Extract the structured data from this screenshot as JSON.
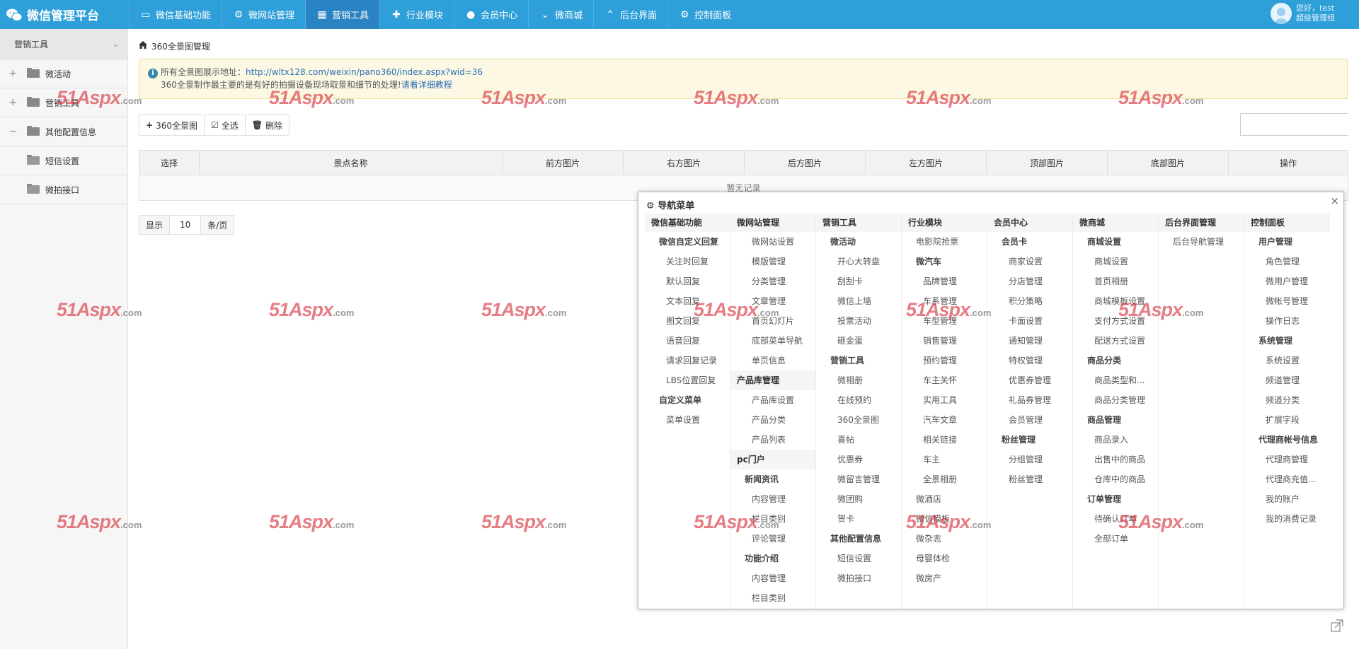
{
  "app": {
    "title": "微信管理平台"
  },
  "nav": [
    {
      "label": "微信基础功能",
      "icon": "monitor-icon",
      "active": false
    },
    {
      "label": "微网站管理",
      "icon": "gear-icon",
      "active": false
    },
    {
      "label": "营销工具",
      "icon": "gift-icon",
      "active": true
    },
    {
      "label": "行业模块",
      "icon": "puzzle-icon",
      "active": false
    },
    {
      "label": "会员中心",
      "icon": "user-icon",
      "active": false
    },
    {
      "label": "微商城",
      "icon": "chevron-down-icon",
      "active": false
    },
    {
      "label": "后台界面",
      "icon": "chevron-up-icon",
      "active": false
    },
    {
      "label": "控制面板",
      "icon": "gear-icon",
      "active": false
    }
  ],
  "user": {
    "greeting": "您好，test",
    "role": "超级管理组"
  },
  "sidebar": {
    "title": "营销工具",
    "items": [
      {
        "label": "微活动",
        "expander": "+"
      },
      {
        "label": "营销工具",
        "expander": "+"
      },
      {
        "label": "其他配置信息",
        "expander": "−"
      },
      {
        "label": "短信设置",
        "expander": ""
      },
      {
        "label": "微拍接口",
        "expander": ""
      }
    ]
  },
  "breadcrumb": {
    "label": "360全景图管理"
  },
  "alert": {
    "prefix": "所有全景图展示地址：",
    "url": "http://wltx128.com/weixin/pano360/index.aspx?wid=36",
    "line2": "360全景制作最主要的是有好的拍摄设备现场取景和细节的处理!",
    "link": "请看详细教程"
  },
  "toolbar": {
    "add": "360全景图",
    "select_all": "全选",
    "delete": "删除"
  },
  "search": {
    "placeholder": ""
  },
  "table": {
    "columns": [
      "选择",
      "景点名称",
      "前方图片",
      "右方图片",
      "后方图片",
      "左方图片",
      "顶部图片",
      "底部图片",
      "操作"
    ],
    "empty": "暂无记录"
  },
  "pager": {
    "prefix": "显示",
    "value": "10",
    "suffix": "条/页"
  },
  "watermark": {
    "brand": "51Aspx",
    "tld": ".com"
  },
  "panel": {
    "title": "导航菜单",
    "columns": [
      {
        "title": "微信基础功能",
        "items": [
          {
            "t": "微信自定义回复",
            "k": "l1"
          },
          {
            "t": "关注时回复",
            "k": "l2"
          },
          {
            "t": "默认回复",
            "k": "l2"
          },
          {
            "t": "文本回复",
            "k": "l2"
          },
          {
            "t": "图文回复",
            "k": "l2"
          },
          {
            "t": "语音回复",
            "k": "l2"
          },
          {
            "t": "请求回复记录",
            "k": "l2"
          },
          {
            "t": "LBS位置回复",
            "k": "l2"
          },
          {
            "t": "自定义菜单",
            "k": "l1"
          },
          {
            "t": "菜单设置",
            "k": "l2"
          }
        ]
      },
      {
        "title": "微网站管理",
        "items": [
          {
            "t": "微网站设置",
            "k": "lc"
          },
          {
            "t": "模版管理",
            "k": "lc"
          },
          {
            "t": "分类管理",
            "k": "lc"
          },
          {
            "t": "文章管理",
            "k": "lc"
          },
          {
            "t": "首页幻灯片",
            "k": "lc"
          },
          {
            "t": "底部菜单导航",
            "k": "lc"
          },
          {
            "t": "单页信息",
            "k": "lc"
          },
          {
            "t": "产品库管理",
            "k": "lp"
          },
          {
            "t": "产品库设置",
            "k": "lc"
          },
          {
            "t": "产品分类",
            "k": "lc"
          },
          {
            "t": "产品列表",
            "k": "lc"
          },
          {
            "t": "pc门户",
            "k": "lp"
          },
          {
            "t": "新闻资讯",
            "k": "lb"
          },
          {
            "t": "内容管理",
            "k": "l2"
          },
          {
            "t": "栏目类别",
            "k": "l2"
          },
          {
            "t": "评论管理",
            "k": "l2"
          },
          {
            "t": "功能介绍",
            "k": "lb"
          },
          {
            "t": "内容管理",
            "k": "l2"
          },
          {
            "t": "栏目类别",
            "k": "l2"
          }
        ]
      },
      {
        "title": "营销工具",
        "items": [
          {
            "t": "微活动",
            "k": "l1"
          },
          {
            "t": "开心大转盘",
            "k": "l2"
          },
          {
            "t": "刮刮卡",
            "k": "l2"
          },
          {
            "t": "微信上墙",
            "k": "l2"
          },
          {
            "t": "投票活动",
            "k": "l2"
          },
          {
            "t": "砸金蛋",
            "k": "l2"
          },
          {
            "t": "营销工具",
            "k": "l1"
          },
          {
            "t": "微相册",
            "k": "l2"
          },
          {
            "t": "在线预约",
            "k": "l2"
          },
          {
            "t": "360全景图",
            "k": "l2"
          },
          {
            "t": "喜帖",
            "k": "l2"
          },
          {
            "t": "优惠券",
            "k": "l2"
          },
          {
            "t": "微留言管理",
            "k": "l2"
          },
          {
            "t": "微团购",
            "k": "l2"
          },
          {
            "t": "贺卡",
            "k": "l2"
          },
          {
            "t": "其他配置信息",
            "k": "l1"
          },
          {
            "t": "短信设置",
            "k": "l2"
          },
          {
            "t": "微拍接口",
            "k": "l2"
          }
        ]
      },
      {
        "title": "行业模块",
        "items": [
          {
            "t": "电影院抢票",
            "k": "l1n"
          },
          {
            "t": "微汽车",
            "k": "l1"
          },
          {
            "t": "品牌管理",
            "k": "l2"
          },
          {
            "t": "车系管理",
            "k": "l2"
          },
          {
            "t": "车型管理",
            "k": "l2"
          },
          {
            "t": "销售管理",
            "k": "l2"
          },
          {
            "t": "预约管理",
            "k": "l2"
          },
          {
            "t": "车主关怀",
            "k": "l2"
          },
          {
            "t": "实用工具",
            "k": "l2"
          },
          {
            "t": "汽车文章",
            "k": "l2"
          },
          {
            "t": "相关链接",
            "k": "l2"
          },
          {
            "t": "车主",
            "k": "l2"
          },
          {
            "t": "全景相册",
            "k": "l2"
          },
          {
            "t": "微酒店",
            "k": "l1n"
          },
          {
            "t": "微信模板",
            "k": "l1n"
          },
          {
            "t": "微杂志",
            "k": "l1n"
          },
          {
            "t": "母婴体检",
            "k": "l1n"
          },
          {
            "t": "微房产",
            "k": "l1n"
          }
        ]
      },
      {
        "title": "会员中心",
        "items": [
          {
            "t": "会员卡",
            "k": "l1"
          },
          {
            "t": "商家设置",
            "k": "l2"
          },
          {
            "t": "分店管理",
            "k": "l2"
          },
          {
            "t": "积分策略",
            "k": "l2"
          },
          {
            "t": "卡面设置",
            "k": "l2"
          },
          {
            "t": "通知管理",
            "k": "l2"
          },
          {
            "t": "特权管理",
            "k": "l2"
          },
          {
            "t": "优惠券管理",
            "k": "l2"
          },
          {
            "t": "礼品券管理",
            "k": "l2"
          },
          {
            "t": "会员管理",
            "k": "l2"
          },
          {
            "t": "粉丝管理",
            "k": "l1"
          },
          {
            "t": "分组管理",
            "k": "l2"
          },
          {
            "t": "粉丝管理",
            "k": "l2"
          }
        ]
      },
      {
        "title": "微商城",
        "items": [
          {
            "t": "商城设置",
            "k": "l1"
          },
          {
            "t": "商城设置",
            "k": "l2"
          },
          {
            "t": "首页相册",
            "k": "l2"
          },
          {
            "t": "商城模板设置",
            "k": "l2"
          },
          {
            "t": "支付方式设置",
            "k": "l2"
          },
          {
            "t": "配送方式设置",
            "k": "l2"
          },
          {
            "t": "商品分类",
            "k": "l1"
          },
          {
            "t": "商品类型和...",
            "k": "l2"
          },
          {
            "t": "商品分类管理",
            "k": "l2"
          },
          {
            "t": "商品管理",
            "k": "l1"
          },
          {
            "t": "商品录入",
            "k": "l2"
          },
          {
            "t": "出售中的商品",
            "k": "l2"
          },
          {
            "t": "仓库中的商品",
            "k": "l2"
          },
          {
            "t": "订单管理",
            "k": "l1"
          },
          {
            "t": "待确认订单",
            "k": "l2"
          },
          {
            "t": "全部订单",
            "k": "l2"
          }
        ]
      },
      {
        "title": "后台界面管理",
        "items": [
          {
            "t": "后台导航管理",
            "k": "l1n"
          }
        ]
      },
      {
        "title": "控制面板",
        "items": [
          {
            "t": "用户管理",
            "k": "l1"
          },
          {
            "t": "角色管理",
            "k": "l2"
          },
          {
            "t": "微用户管理",
            "k": "l2"
          },
          {
            "t": "微帐号管理",
            "k": "l2"
          },
          {
            "t": "操作日志",
            "k": "l2"
          },
          {
            "t": "系统管理",
            "k": "l1"
          },
          {
            "t": "系统设置",
            "k": "l2"
          },
          {
            "t": "频道管理",
            "k": "l2"
          },
          {
            "t": "频道分类",
            "k": "l2"
          },
          {
            "t": "扩展字段",
            "k": "l2"
          },
          {
            "t": "代理商帐号信息",
            "k": "l1"
          },
          {
            "t": "代理商管理",
            "k": "l2"
          },
          {
            "t": "代理商充值...",
            "k": "l2"
          },
          {
            "t": "我的账户",
            "k": "l2"
          },
          {
            "t": "我的消费记录",
            "k": "l2"
          }
        ]
      }
    ]
  }
}
